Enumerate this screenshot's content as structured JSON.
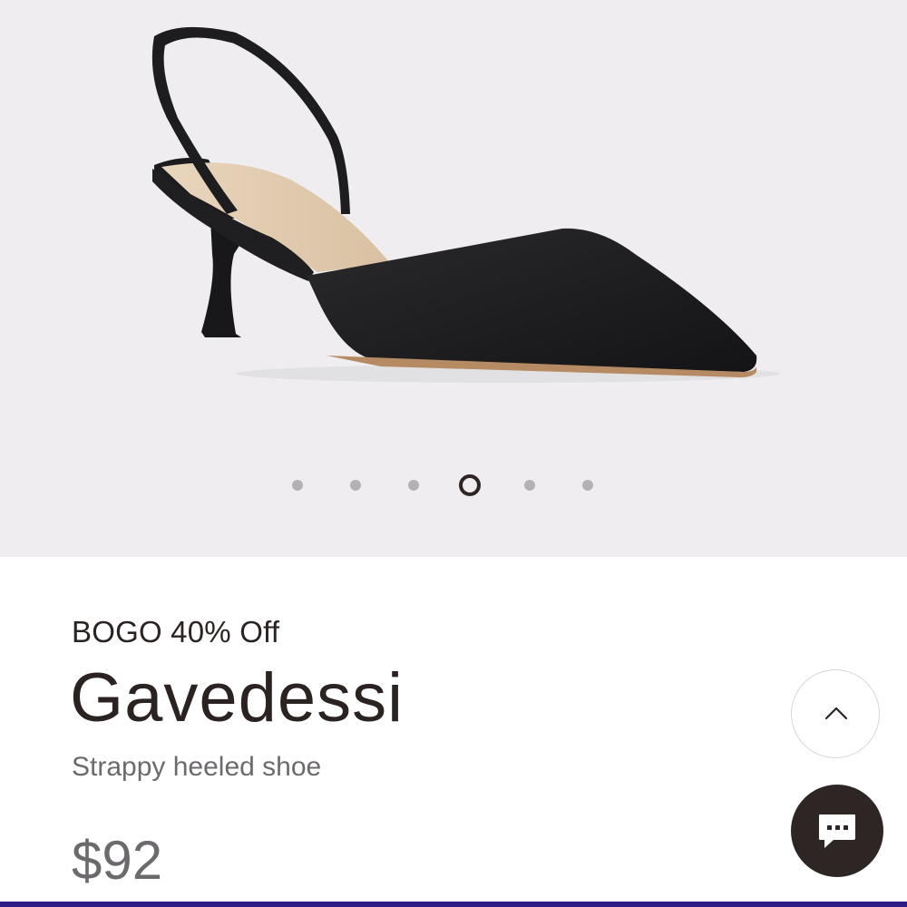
{
  "product": {
    "promo": "BOGO 40% Off",
    "name": "Gavedessi",
    "description": "Strappy heeled shoe",
    "price": "$92"
  },
  "gallery": {
    "image_count": 6,
    "active_index": 3,
    "image_subject": "black pointed-toe slingback kitten heel"
  },
  "icons": {
    "scroll_top": "chevron-up-icon",
    "chat": "chat-bubble-icon"
  },
  "colors": {
    "gallery_background": "#efedf0",
    "text_primary": "#2b2322",
    "text_secondary": "#6d6a6d",
    "chat_button": "#2d2625",
    "bottom_bar": "#2f1d86"
  }
}
